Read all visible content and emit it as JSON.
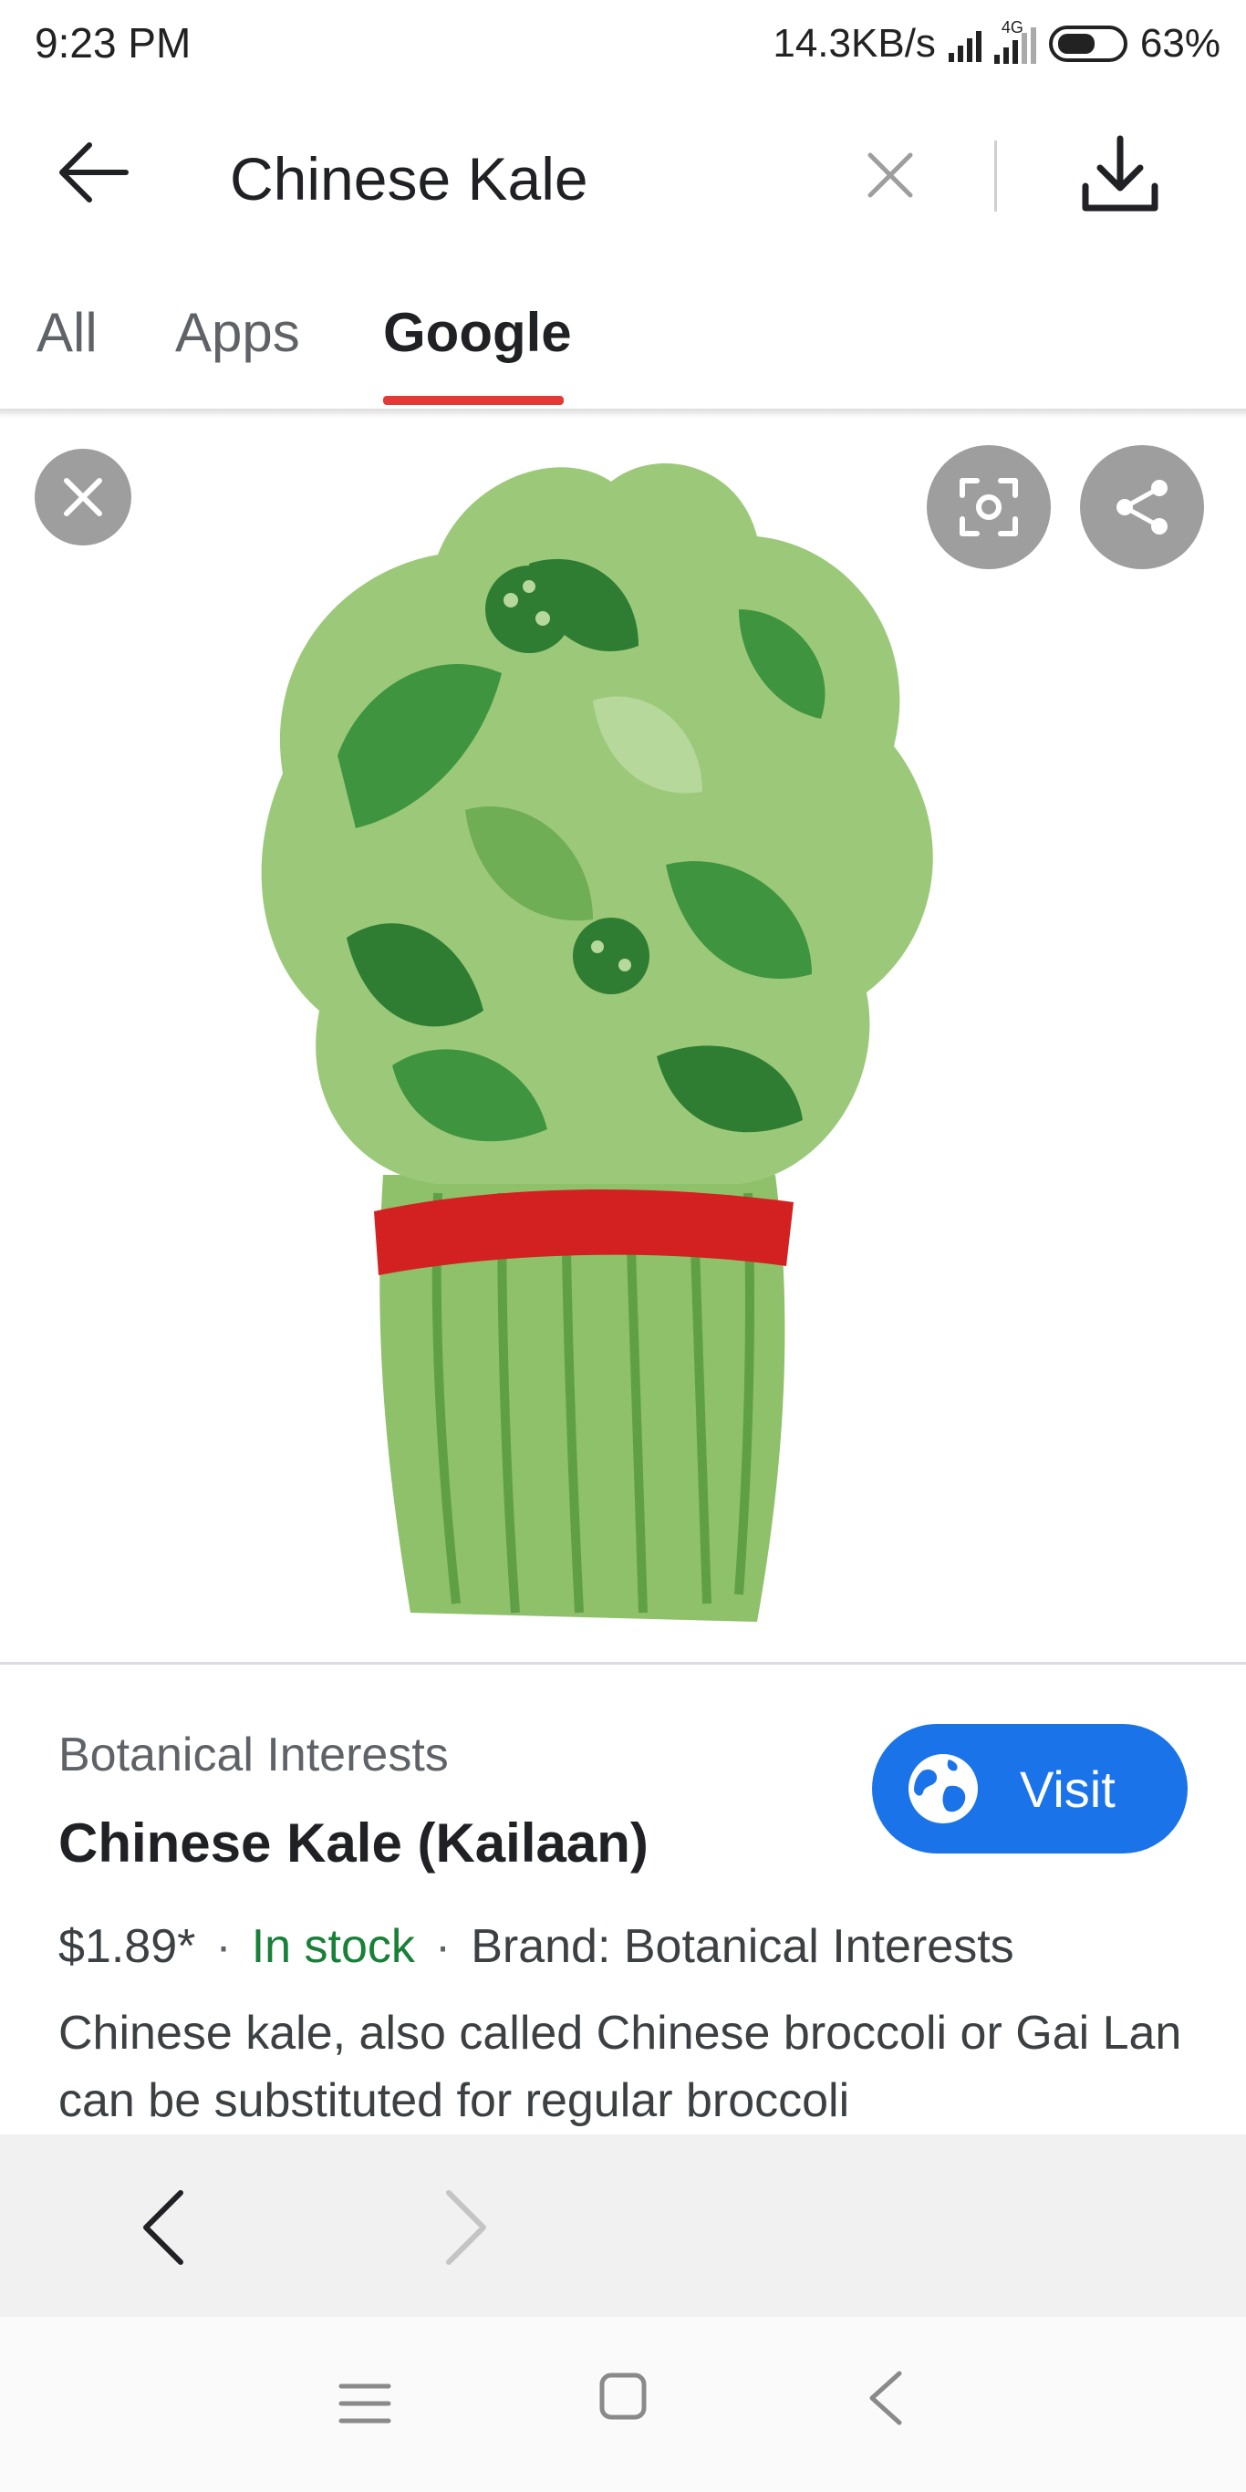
{
  "status_bar": {
    "time": "9:23 PM",
    "speed": "14.3KB/s",
    "network_tag": "4G",
    "battery": "63%",
    "battery_level": 0.63
  },
  "app_bar": {
    "query": "Chinese Kale",
    "icons": [
      "back-arrow-icon",
      "clear-icon",
      "download-icon"
    ]
  },
  "tabs": [
    {
      "label": "All",
      "active": false
    },
    {
      "label": "Apps",
      "active": false
    },
    {
      "label": "Google",
      "active": true
    }
  ],
  "colors": {
    "accent_red": "#e53935",
    "visit_blue": "#1a73e8",
    "stock_green": "#188038",
    "kale_light": "#8fc06a",
    "kale_dark": "#2e7d32",
    "band_red": "#d32020"
  },
  "viewer": {
    "icons": [
      "close-icon",
      "lens-icon",
      "share-icon"
    ],
    "image_subject": "Bunch of Chinese kale tied with red band"
  },
  "result": {
    "source": "Botanical Interests",
    "title": "Chinese Kale (Kailaan)",
    "visit_label": "Visit",
    "price": "$1.89*",
    "separator": "·",
    "stock": "In stock",
    "brand": "Brand: Botanical Interests",
    "description": "Chinese kale, also called Chinese broccoli or Gai Lan can be substituted for regular broccoli"
  },
  "browser_nav": {
    "icons": [
      "nav-back-icon",
      "nav-forward-icon"
    ]
  },
  "system_nav": {
    "icons": [
      "menu-icon",
      "home-icon",
      "back-icon"
    ]
  }
}
